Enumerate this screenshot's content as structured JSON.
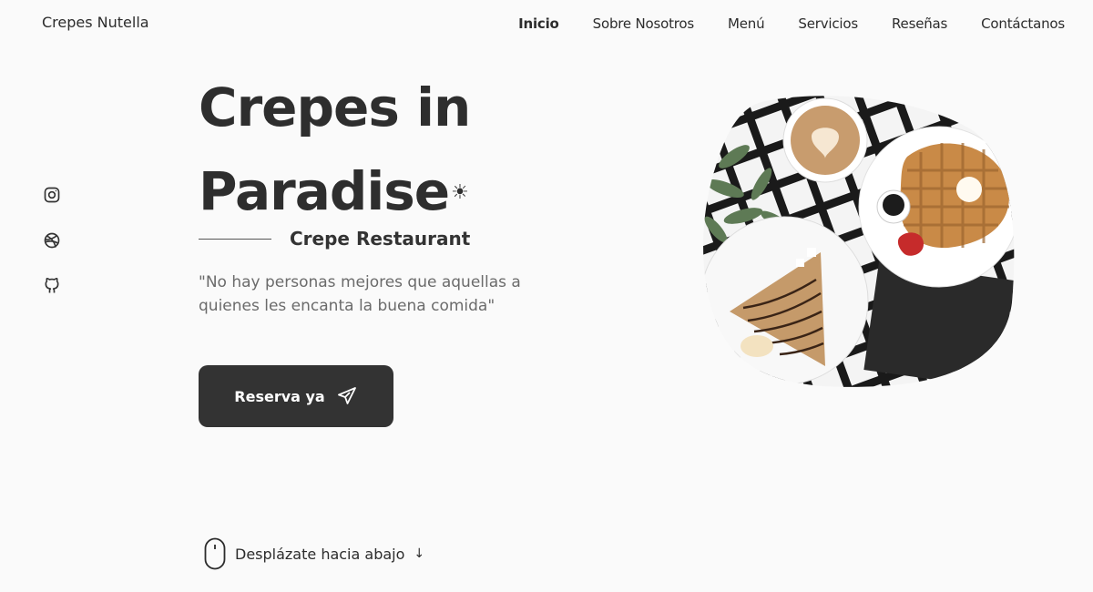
{
  "brand": "Crepes Nutella",
  "nav": [
    "Inicio",
    "Sobre Nosotros",
    "Menú",
    "Servicios",
    "Reseñas",
    "Contáctanos"
  ],
  "social": [
    "instagram-icon",
    "dribbble-icon",
    "github-icon"
  ],
  "hero": {
    "title_line1": "Crepes in",
    "title_line2": "Paradise",
    "title_mark": "☀",
    "subtitle": "Crepe Restaurant",
    "quote": "\"No hay personas mejores que aquellas a quienes les encanta la buena comida\"",
    "cta": "Reserva ya"
  },
  "scroll": {
    "label": "Desplázate hacia abajo",
    "arrow": "↓"
  },
  "image": {
    "alt": "crepes and waffles with coffee"
  }
}
